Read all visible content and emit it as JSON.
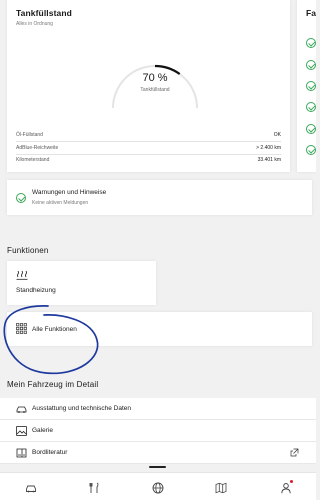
{
  "tank": {
    "title": "Tankfüllstand",
    "subtitle": "Alles in Ordnung",
    "gauge_value": "70 %",
    "gauge_fraction": 0.7,
    "gauge_label": "Tankfüllstand",
    "rows": [
      {
        "label": "Öl-Füllstand",
        "value": "OK"
      },
      {
        "label": "AdBlue-Reichweite",
        "value": "> 2.400 km"
      },
      {
        "label": "Kilometerstand",
        "value": "33.401 km"
      }
    ]
  },
  "side_card": {
    "title": "Fa"
  },
  "warnings": {
    "title": "Warnungen und Hinweise",
    "subtitle": "Keine aktiven Meldungen"
  },
  "functions": {
    "section_title": "Funktionen",
    "heater_label": "Standheizung",
    "all_label": "Alle Funktionen"
  },
  "details": {
    "section_title": "Mein Fahrzeug im Detail",
    "items": [
      {
        "label": "Ausstattung und technische Daten",
        "icon": "equipment-icon"
      },
      {
        "label": "Galerie",
        "icon": "gallery-icon"
      },
      {
        "label": "Bordliteratur",
        "icon": "book-icon"
      }
    ]
  },
  "tabbar": {
    "tabs": [
      "car-icon",
      "service-icon",
      "globe-icon",
      "map-icon",
      "profile-icon"
    ]
  },
  "colors": {
    "accent_green": "#3aa85a",
    "annotation_blue": "#1e3a9e",
    "badge_red": "#d4202a"
  }
}
